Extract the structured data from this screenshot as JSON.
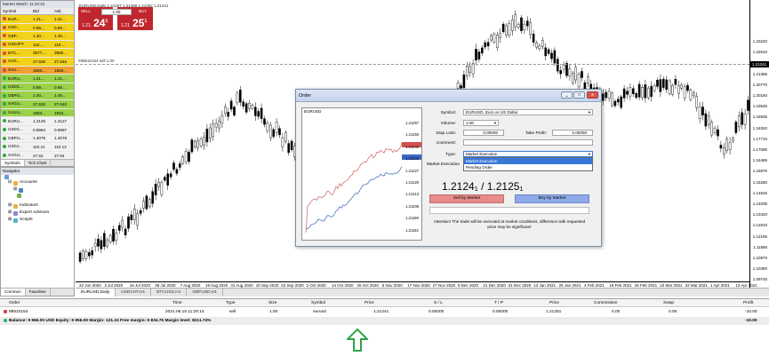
{
  "market_watch": {
    "title": "Market Watch: 11:20:22",
    "columns": [
      "Symbol",
      "Bid",
      "Ask"
    ],
    "rows": [
      {
        "symbol": "EUR...",
        "bid": "1.21...",
        "ask": "1.21...",
        "color": "#f3d21a",
        "dir": "down"
      },
      {
        "symbol": "USD...",
        "bid": "0.89...",
        "ask": "0.89...",
        "color": "#f3d21a",
        "dir": "down"
      },
      {
        "symbol": "GBP...",
        "bid": "1.40...",
        "ask": "1.40...",
        "color": "#f3d21a",
        "dir": "down"
      },
      {
        "symbol": "USDJPY",
        "bid": "110....",
        "ask": "110....",
        "color": "#f3d21a",
        "dir": "down"
      },
      {
        "symbol": "BTC...",
        "bid": "3977...",
        "ask": "3980...",
        "color": "#f3d21a",
        "dir": "down"
      },
      {
        "symbol": "XAG...",
        "bid": "27.626",
        "ask": "27.646",
        "color": "#f3d21a",
        "dir": "down"
      },
      {
        "symbol": "XAU...",
        "bid": "1863...",
        "ask": "1863...",
        "color": "#f0a030",
        "dir": "down"
      },
      {
        "symbol": "EURU...",
        "bid": "1.21...",
        "ask": "1.21...",
        "color": "#9ad24a",
        "dir": "up"
      },
      {
        "symbol": "USDC...",
        "bid": "0.89...",
        "ask": "0.89...",
        "color": "#9ad24a",
        "dir": "up"
      },
      {
        "symbol": "GBPU...",
        "bid": "1.40...",
        "ask": "1.40...",
        "color": "#9ad24a",
        "dir": "up"
      },
      {
        "symbol": "XAGU...",
        "bid": "27.632",
        "ask": "27.640",
        "color": "#9ad24a",
        "dir": "up"
      },
      {
        "symbol": "XAUU...",
        "bid": "1863...",
        "ask": "1863...",
        "color": "#9ad24a",
        "dir": "up"
      },
      {
        "symbol": "EURU...",
        "bid": "1.2125",
        "ask": "1.2127",
        "color": "#f2f2f2",
        "dir": "up"
      },
      {
        "symbol": "USDC...",
        "bid": "0.8984",
        "ask": "0.8987",
        "color": "#f2f2f2",
        "dir": "up"
      },
      {
        "symbol": "GBPU...",
        "bid": "1.4075",
        "ask": "1.4078",
        "color": "#f2f2f2",
        "dir": "up"
      },
      {
        "symbol": "USDJ...",
        "bid": "110.11",
        "ask": "110.13",
        "color": "#f2f2f2",
        "dir": "up"
      },
      {
        "symbol": "XAGU...",
        "bid": "27.62",
        "ask": "27.64",
        "color": "#f2f2f2",
        "dir": "up"
      }
    ],
    "tabs": [
      "Symbols",
      "Tick Chart"
    ]
  },
  "navigator": {
    "title": "Navigator",
    "items": {
      "accounts": "Accounts",
      "indicators": "Indicators",
      "experts": "Expert Advisors",
      "scripts": "Scripts"
    },
    "tabs": [
      "Common",
      "Favorites"
    ]
  },
  "chart": {
    "title": "EURUSD,Daily  1.21207 1.21468 1.21252 1.21241",
    "hline_label": "#88510154 sell 1.00",
    "current_price": "1.21241",
    "yticks": [
      "1.23220",
      "1.22610",
      "1.21995",
      "1.21385",
      "1.20770",
      "1.20160",
      "1.19545",
      "1.18935",
      "1.18320",
      "1.17710",
      "1.17095",
      "1.16485",
      "1.15870",
      "1.15260",
      "1.14645",
      "1.14035",
      "1.13420",
      "1.12810",
      "1.12195",
      "1.11585",
      "1.10970",
      "1.10360",
      "1.09745",
      "1.09135",
      "1.08520",
      "1.07910"
    ],
    "xticks": [
      "22 Jun 2020",
      "3 Jul 2020",
      "16 Jul 2020",
      "28 Jul 2020",
      "7 Aug 2020",
      "19 Aug 2020",
      "31 Aug 2020",
      "10 Sep 2020",
      "22 Sep 2020",
      "2 Oct 2020",
      "14 Oct 2020",
      "26 Oct 2020",
      "5 Nov 2020",
      "17 Nov 2020",
      "27 Nov 2020",
      "9 Dec 2020",
      "21 Dec 2020",
      "31 Dec 2020",
      "13 Jan 2021",
      "25 Jan 2021",
      "4 Feb 2021",
      "16 Feb 2021",
      "26 Feb 2021",
      "10 Mar 2021",
      "22 Mar 2021",
      "1 Apr 2021",
      "13 Apr 2021"
    ]
  },
  "one_click": {
    "sell_label": "SELL",
    "buy_label": "BUY",
    "volume": "1.00",
    "sell_price_small": "1.21",
    "sell_price_big": "24",
    "sell_price_sup": "1",
    "buy_price_small": "1.21",
    "buy_price_big": "25",
    "buy_price_sup": "1"
  },
  "chart_tabs": [
    "EURUSD,Daily",
    "USDCHF,H1",
    "BTCUSD,H1",
    "GBPUSD,H1"
  ],
  "terminal": {
    "columns": [
      "Order",
      "Time",
      "Type",
      "Size",
      "Symbol",
      "Price",
      "S / L",
      "T / P",
      "Price",
      "Commission",
      "Swap",
      "Profit"
    ],
    "order_row": [
      "88510154",
      "2021.06.15 11:20:14",
      "sell",
      "1.00",
      "eurusd",
      "1.21241",
      "0.00000",
      "0.00000",
      "1.21251",
      "0.00",
      "0.00",
      "-10.00"
    ],
    "balance": "Balance: 9 966.00 USD  Equity: 9 956.00  Margin: 121.24  Free margin: 9 834.76  Margin level: 8211.74%",
    "balance_profit": "-10.00"
  },
  "order_dialog": {
    "title": "Order",
    "mini_symbol": "EURUSD",
    "mini_ticks": [
      "1.21257",
      "1.21250",
      "1.21241",
      "1.21234",
      "1.21227",
      "1.21220",
      "1.21213",
      "1.21206",
      "1.21199",
      "1.21192"
    ],
    "symbol_label": "Symbol:",
    "symbol_value": "EURUSD, Euro vs US Dollar",
    "volume_label": "Volume:",
    "volume_value": "1.00",
    "sl_label": "Stop Loss:",
    "sl_value": "0.00000",
    "tp_label": "Take Profit:",
    "tp_value": "0.00000",
    "comment_label": "Comment:",
    "type_label": "Type:",
    "type_value": "Market Execution",
    "type_options": [
      "Market Execution",
      "Pending Order"
    ],
    "exec_label": "Market Execution",
    "price_pair": "1.2124₁ / 1.2125₁",
    "sell_button": "Sell by Market",
    "buy_button": "Buy by Market",
    "attention": "Attention! The trade will be executed at market conditions, difference with requested price may be significant!"
  }
}
